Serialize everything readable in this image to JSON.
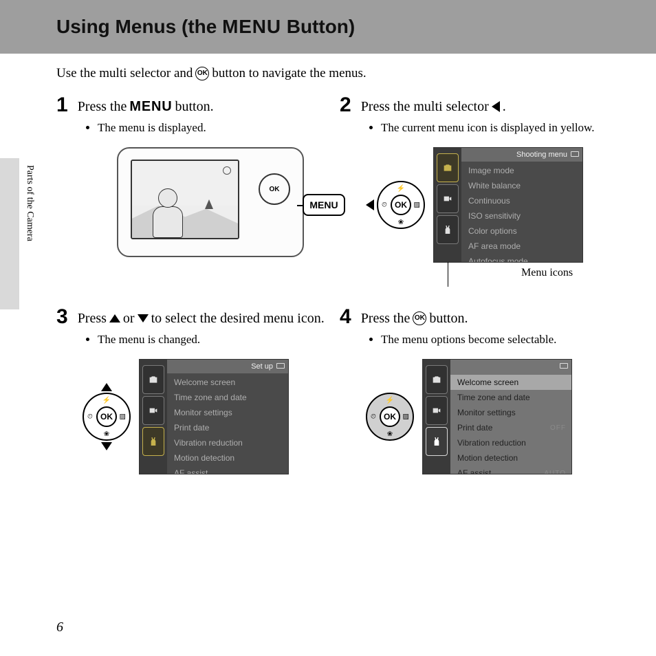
{
  "page_number": "6",
  "header_title_prefix": "Using Menus (the ",
  "header_menu_word": "MENU",
  "header_title_suffix": " Button)",
  "intro": {
    "p1a": "Use the multi selector and ",
    "p1b": " button to navigate the menus."
  },
  "side_tab_label": "Parts of the Camera",
  "ok_label": "OK",
  "steps": {
    "s1": {
      "num": "1",
      "title_a": "Press the ",
      "title_menu": "MENU",
      "title_b": " button.",
      "bullet": "The menu is displayed.",
      "menu_btn_label": "MENU"
    },
    "s2": {
      "num": "2",
      "title_a": "Press the multi selector ",
      "title_b": ".",
      "bullet": "The current menu icon is displayed in yellow.",
      "caption": "Menu icons",
      "screen": {
        "header": "Shooting menu",
        "rows": [
          "Image mode",
          "White balance",
          "Continuous",
          "ISO sensitivity",
          "Color options",
          "AF area mode",
          "Autofocus mode"
        ]
      }
    },
    "s3": {
      "num": "3",
      "title_a": "Press ",
      "title_mid": " or ",
      "title_b": " to select the desired menu icon.",
      "bullet": "The menu is changed.",
      "screen": {
        "header": "Set up",
        "rows": [
          "Welcome screen",
          "Time zone and date",
          "Monitor settings",
          "Print date",
          "Vibration reduction",
          "Motion detection",
          "AF assist"
        ]
      }
    },
    "s4": {
      "num": "4",
      "title_a": "Press the ",
      "title_b": " button.",
      "bullet": "The menu options become selectable.",
      "screen": {
        "header": "",
        "rows": [
          {
            "label": "Welcome screen",
            "val": ""
          },
          {
            "label": "Time zone and date",
            "val": ""
          },
          {
            "label": "Monitor settings",
            "val": ""
          },
          {
            "label": "Print date",
            "val": "OFF"
          },
          {
            "label": "Vibration reduction",
            "val": ""
          },
          {
            "label": "Motion detection",
            "val": ""
          },
          {
            "label": "AF assist",
            "val": "AUTO"
          }
        ]
      }
    }
  }
}
